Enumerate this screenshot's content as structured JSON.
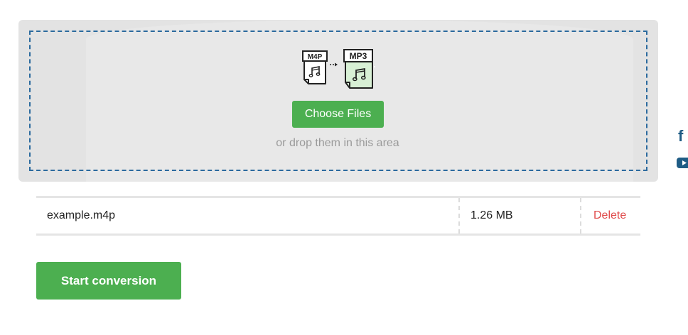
{
  "upload": {
    "choose_files_label": "Choose Files",
    "drop_hint": "or drop them in this area",
    "source_format": "M4P",
    "target_format": "MP3"
  },
  "files": [
    {
      "name": "example.m4p",
      "size": "1.26 MB",
      "action": "Delete"
    }
  ],
  "actions": {
    "start_label": "Start conversion"
  },
  "social": {
    "facebook_glyph": "f",
    "icons": [
      "facebook-icon",
      "youtube-icon"
    ]
  },
  "colors": {
    "accent_green": "#4caf50",
    "delete_red": "#e04a4a",
    "dash_blue": "#2b6a9e",
    "panel_gray": "#e3e3e3",
    "social_blue": "#1f5c85"
  }
}
